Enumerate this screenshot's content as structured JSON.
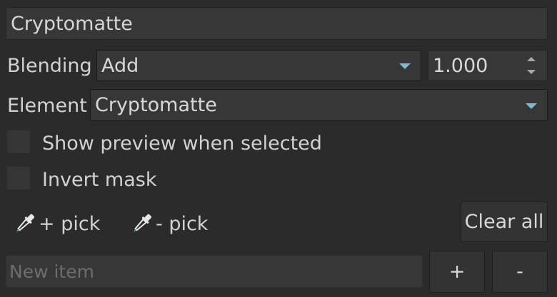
{
  "name_field": {
    "value": "Cryptomatte"
  },
  "blending": {
    "label": "Blending",
    "selected": "Add",
    "amount": "1.000"
  },
  "element": {
    "label": "Element",
    "selected": "Cryptomatte"
  },
  "checkboxes": [
    {
      "label": "Show preview when selected",
      "checked": false
    },
    {
      "label": "Invert mask",
      "checked": false
    }
  ],
  "pickers": {
    "add_pick_label": "+ pick",
    "remove_pick_label": "- pick"
  },
  "buttons": {
    "clear_all": "Clear all",
    "add": "+",
    "remove": "-"
  },
  "new_item": {
    "placeholder": "New item",
    "value": ""
  },
  "colors": {
    "background": "#2b2b2b",
    "field": "#373737",
    "accent_arrow": "#7fb9d6"
  },
  "icons": {
    "picker": "eyedropper-icon",
    "dropdown": "chevron-down-icon",
    "spin_up": "spin-up-icon",
    "spin_down": "spin-down-icon"
  }
}
